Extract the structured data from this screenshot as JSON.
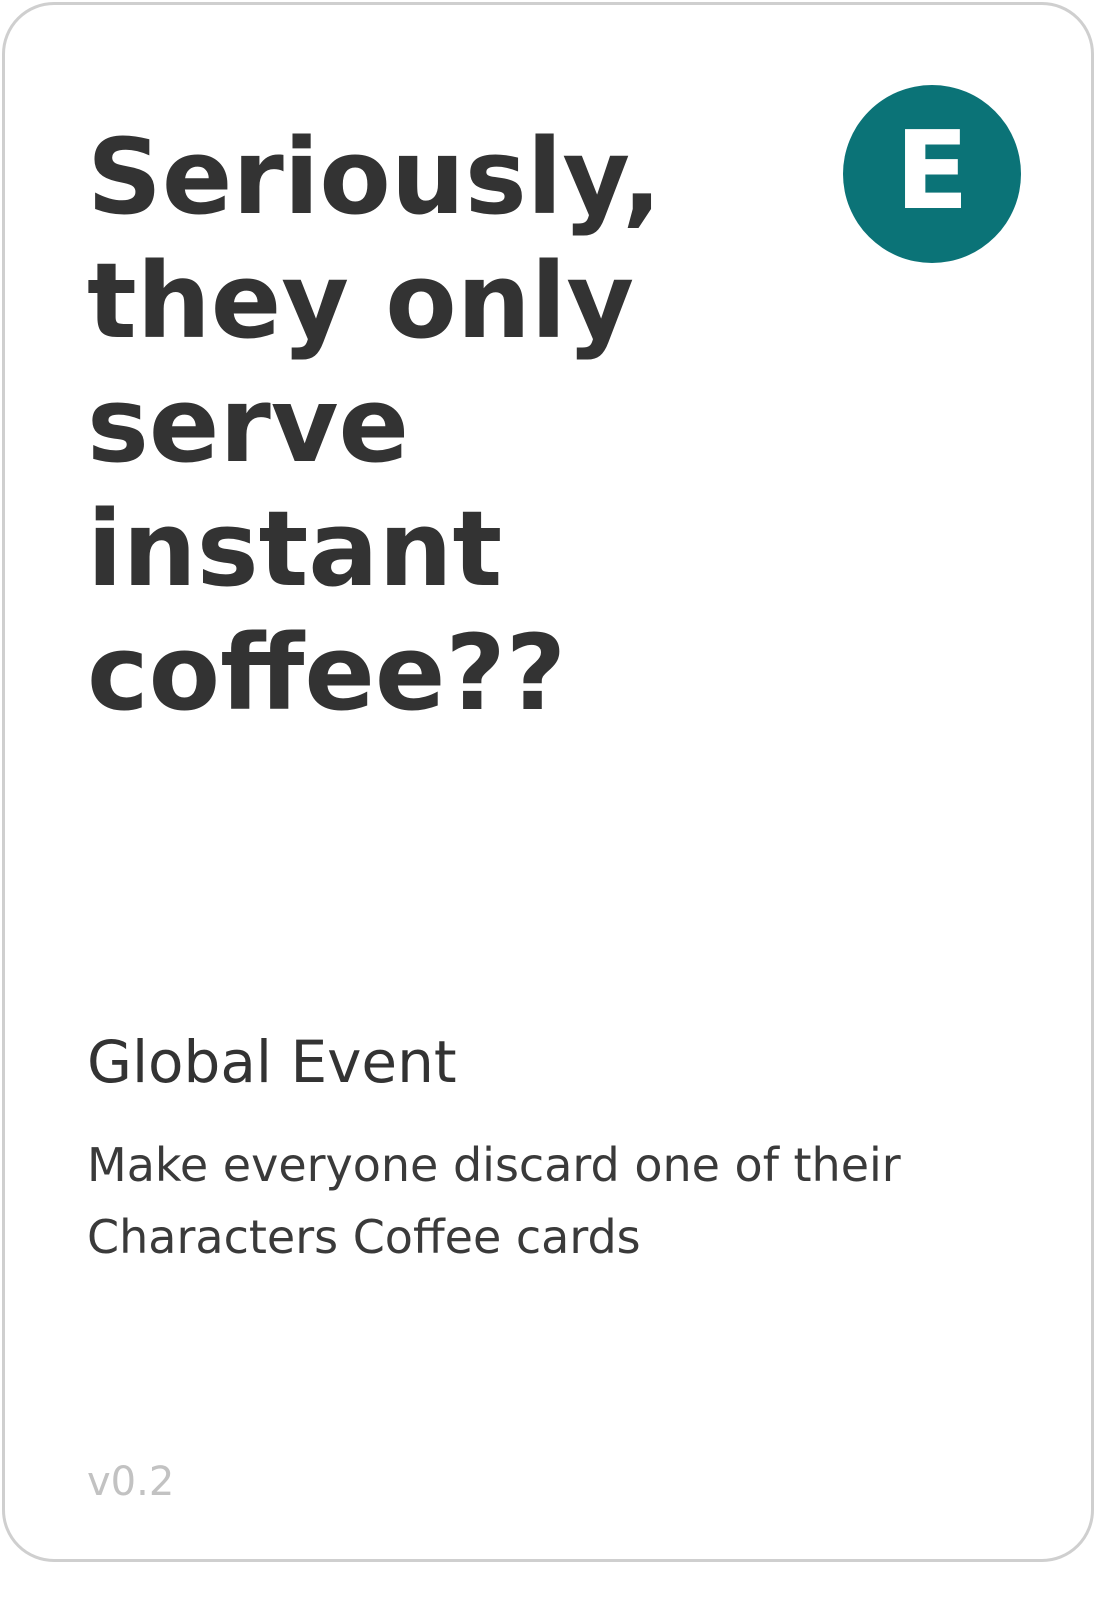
{
  "card": {
    "title": "Seriously, they only serve instant coffee??",
    "badge_letter": "E",
    "type": "Global Event",
    "description": "Make everyone discard one of their Characters Coffee cards",
    "version": "v0.2"
  },
  "colors": {
    "badge": "#0b7377",
    "text": "#333333",
    "border": "#cfcfcf",
    "version": "#c2c2c2"
  }
}
